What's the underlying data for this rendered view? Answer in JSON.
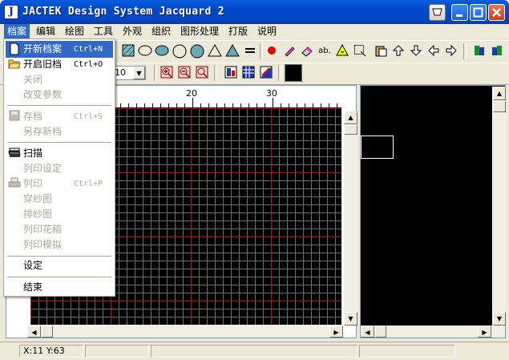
{
  "window": {
    "title": "JACTEK Design System Jacquard 2"
  },
  "menubar": [
    "档案",
    "编辑",
    "绘图",
    "工具",
    "外观",
    "组织",
    "图形处理",
    "打版",
    "说明"
  ],
  "file_menu": {
    "items": [
      {
        "label": "开新档案",
        "shortcut": "Ctrl+N",
        "enabled": true,
        "highlighted": true,
        "icon": "new-file-icon"
      },
      {
        "label": "开启旧档",
        "shortcut": "Ctrl+O",
        "enabled": true,
        "icon": "open-folder-icon"
      },
      {
        "label": "关闭",
        "enabled": false
      },
      {
        "label": "改变参数",
        "enabled": false
      },
      {
        "label": "存档",
        "shortcut": "Ctrl+S",
        "enabled": false,
        "icon": "save-icon"
      },
      {
        "label": "另存新档",
        "enabled": false
      },
      {
        "label": "扫描",
        "enabled": true,
        "icon": "scanner-icon"
      },
      {
        "label": "列印设定",
        "enabled": false
      },
      {
        "label": "列印",
        "shortcut": "Ctrl+P",
        "enabled": false,
        "icon": "printer-icon"
      },
      {
        "label": "穿纱图",
        "enabled": false
      },
      {
        "label": "排纱图",
        "enabled": false
      },
      {
        "label": "列印花稿",
        "enabled": false
      },
      {
        "label": "列印模拟",
        "enabled": false
      },
      {
        "label": "设定",
        "enabled": true
      },
      {
        "label": "结束",
        "enabled": true
      }
    ]
  },
  "toolbar2": {
    "zoom_value": "10"
  },
  "ruler": {
    "labels": [
      "20",
      "30"
    ]
  },
  "status": {
    "coords": "X:11 Y:63"
  },
  "colors": {
    "title_blue": "#0048c8",
    "menu_highlight": "#316ac5",
    "grid_line": "#6a6a6a",
    "grid_major": "#d20000",
    "canvas_bg": "#000000"
  }
}
